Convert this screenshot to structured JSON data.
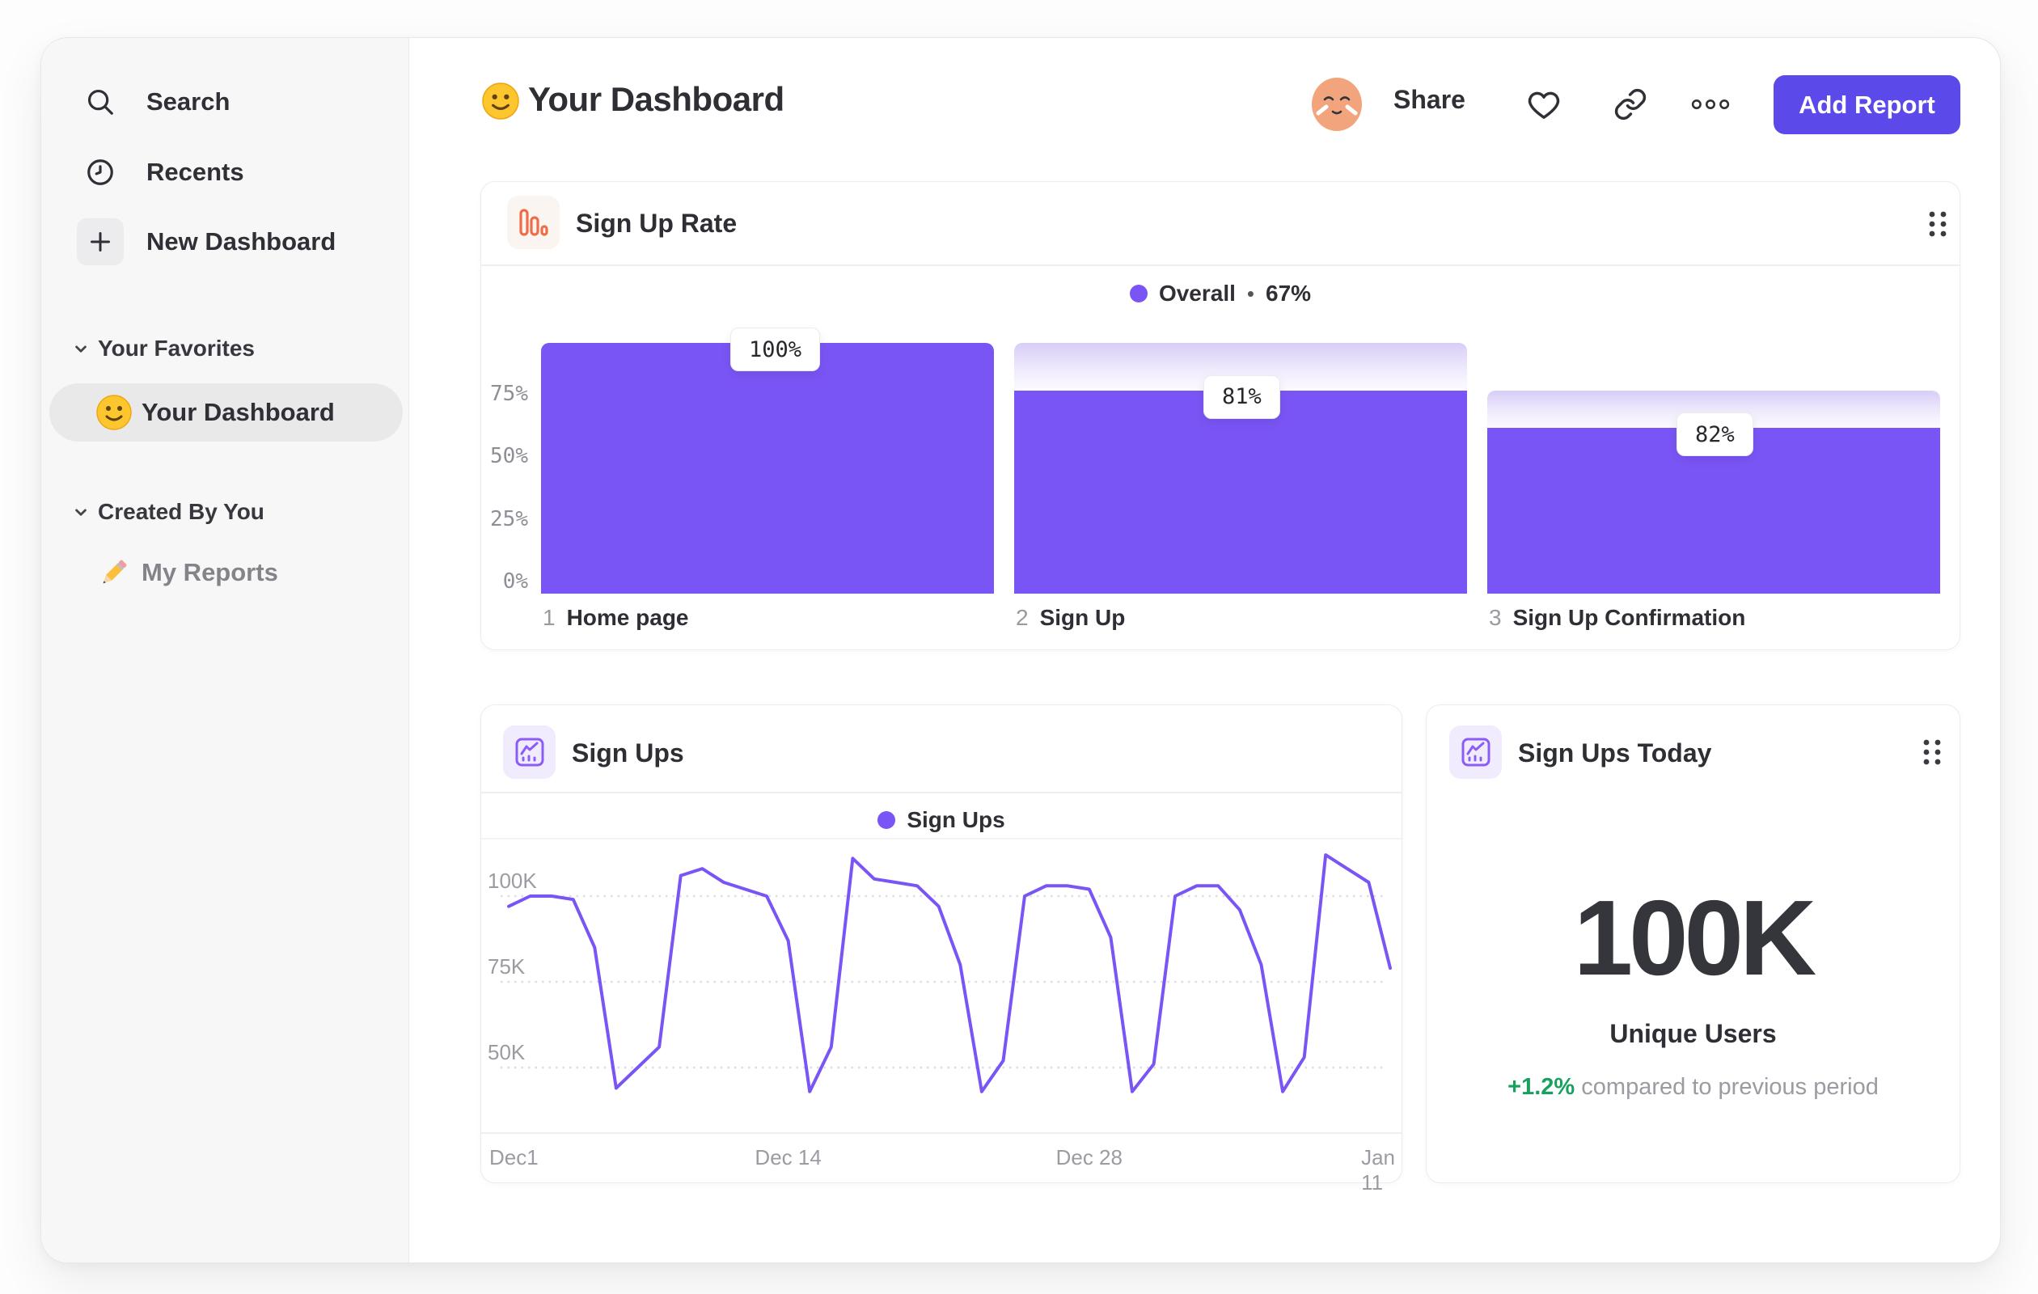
{
  "sidebar": {
    "nav": [
      {
        "label": "Search",
        "icon": "search-icon"
      },
      {
        "label": "Recents",
        "icon": "clock-icon"
      },
      {
        "label": "New Dashboard",
        "icon": "plus-icon"
      }
    ],
    "sections": [
      {
        "title": "Your Favorites",
        "items": [
          {
            "label": "Your Dashboard",
            "emoji": "slightly-smiling-face",
            "selected": true
          }
        ]
      },
      {
        "title": "Created By You",
        "items": [
          {
            "label": "My Reports",
            "emoji": "pencil",
            "selected": false
          }
        ]
      }
    ]
  },
  "header": {
    "emoji": "slightly-smiling-face",
    "title": "Your Dashboard",
    "share_label": "Share",
    "add_report_label": "Add Report"
  },
  "funnel_card": {
    "title": "Sign Up Rate",
    "legend_label": "Overall",
    "legend_separator": "•",
    "legend_value": "67%"
  },
  "line_card": {
    "title": "Sign Ups",
    "legend_label": "Sign Ups"
  },
  "metric_card": {
    "title": "Sign Ups Today",
    "value": "100K",
    "subtitle": "Unique Users",
    "delta": "+1.2%",
    "delta_note": "compared to previous period"
  },
  "colors": {
    "accent_purple": "#7a55f5",
    "button_indigo": "#5b49ea",
    "icon_orange": "#ee6d48",
    "icon_purple": "#8b5cf6",
    "delta_green": "#18a05f",
    "text_dark": "#2f2f36",
    "text_muted": "#9b9ba2"
  },
  "chart_data": [
    {
      "id": "sign-up-rate-funnel",
      "type": "bar",
      "title": "Sign Up Rate",
      "legend": [
        {
          "label": "Overall",
          "value": "67%",
          "color": "#7a55f5"
        }
      ],
      "categories": [
        "Home page",
        "Sign Up",
        "Sign Up Confirmation"
      ],
      "step_indices": [
        "1",
        "2",
        "3"
      ],
      "badge_labels": [
        "100%",
        "81%",
        "82%"
      ],
      "step_conversion_pct": [
        100,
        81,
        82
      ],
      "overall_height_pct": [
        100,
        81,
        66
      ],
      "prev_height_pct": [
        100,
        100,
        81
      ],
      "y_ticks": [
        "75%",
        "50%",
        "25%",
        "0%"
      ],
      "y_tick_values": [
        75,
        50,
        25,
        0
      ],
      "ylim": [
        0,
        100
      ],
      "grid": false,
      "legend_position": "top-center"
    },
    {
      "id": "sign-ups-line",
      "type": "line",
      "title": "Sign Ups",
      "series": [
        {
          "name": "Sign Ups",
          "color": "#7a55f5",
          "values_k": [
            97,
            100,
            100,
            99,
            85,
            44,
            50,
            56,
            106,
            108,
            104,
            102,
            100,
            87,
            43,
            56,
            111,
            105,
            104,
            103,
            97,
            80,
            43,
            52,
            100,
            103,
            103,
            102,
            88,
            43,
            51,
            100,
            103,
            103,
            96,
            80,
            43,
            53,
            112,
            108,
            104,
            79
          ]
        }
      ],
      "x_ticks": [
        "Dec1",
        "Dec 14",
        "Dec 28",
        "Jan 11"
      ],
      "x_tick_indices": [
        0,
        13,
        27,
        41
      ],
      "y_ticks": [
        "100K",
        "75K",
        "50K"
      ],
      "y_tick_values_k": [
        100,
        75,
        50
      ],
      "ylim_k": [
        38,
        115
      ],
      "grid": "dashed-horizontal",
      "legend_position": "top-center"
    }
  ]
}
